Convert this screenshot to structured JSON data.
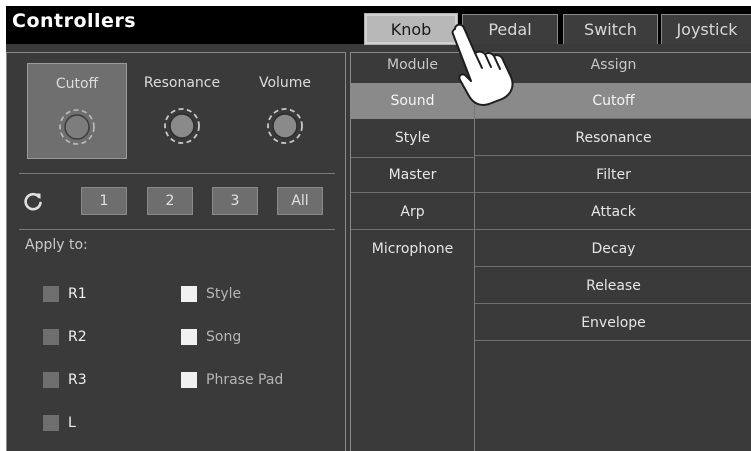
{
  "header": {
    "title": "Controllers",
    "tabs": [
      {
        "label": "Knob",
        "active": true
      },
      {
        "label": "Pedal",
        "active": false
      },
      {
        "label": "Switch",
        "active": false
      },
      {
        "label": "Joystick",
        "active": false
      }
    ]
  },
  "knobs": [
    {
      "label": "Cutoff",
      "selected": true
    },
    {
      "label": "Resonance",
      "selected": false
    },
    {
      "label": "Volume",
      "selected": false
    }
  ],
  "presets": [
    "1",
    "2",
    "3",
    "All"
  ],
  "reset_icon": "refresh-icon",
  "apply": {
    "label": "Apply to:",
    "parts": [
      {
        "label": "R1",
        "checked": false
      },
      {
        "label": "R2",
        "checked": false
      },
      {
        "label": "R3",
        "checked": false
      },
      {
        "label": "L",
        "checked": false
      }
    ],
    "sources": [
      {
        "label": "Style",
        "checked": true
      },
      {
        "label": "Song",
        "checked": true
      },
      {
        "label": "Phrase Pad",
        "checked": true
      }
    ]
  },
  "assign_table": {
    "module_header": "Module",
    "assign_header": "Assign",
    "modules": [
      {
        "label": "Sound",
        "active": true
      },
      {
        "label": "Style",
        "active": false
      },
      {
        "label": "Master",
        "active": false
      },
      {
        "label": "Arp",
        "active": false
      },
      {
        "label": "Microphone",
        "active": false
      }
    ],
    "assigns": [
      {
        "label": "Cutoff",
        "active": true
      },
      {
        "label": "Resonance",
        "active": false
      },
      {
        "label": "Filter",
        "active": false
      },
      {
        "label": "Attack",
        "active": false
      },
      {
        "label": "Decay",
        "active": false
      },
      {
        "label": "Release",
        "active": false
      },
      {
        "label": "Envelope",
        "active": false
      }
    ]
  },
  "colors": {
    "background": "#3a3a3a",
    "header": "#000000",
    "selection": "#8a8a8a",
    "active_tab": "#b8b8b8"
  },
  "overlay_icon": "pointing-hand-icon"
}
